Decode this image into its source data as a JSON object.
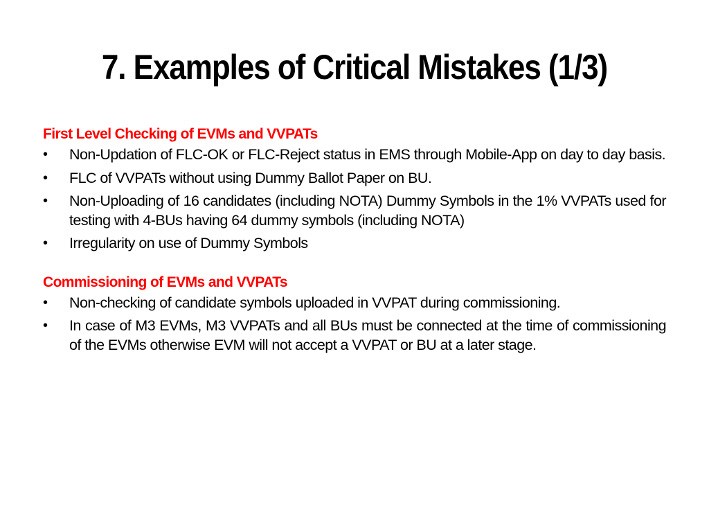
{
  "slide": {
    "title": "7. Examples of Critical Mistakes (1/3)",
    "accent_color": "#ff0000",
    "bullet_glyph": "•",
    "sections": [
      {
        "heading": "First Level Checking of EVMs and VVPATs",
        "items": [
          "Non-Updation of FLC-OK or FLC-Reject status in EMS through Mobile-App on day to day basis.",
          "FLC of VVPATs without using Dummy Ballot Paper on BU.",
          "Non-Uploading of 16 candidates (including NOTA) Dummy Symbols in the 1% VVPATs used for testing with 4-BUs having 64 dummy symbols (including NOTA)",
          "Irregularity on use of Dummy Symbols"
        ]
      },
      {
        "heading": "Commissioning of EVMs and VVPATs",
        "items": [
          "Non-checking of candidate symbols uploaded in VVPAT during commissioning.",
          "In case of M3 EVMs, M3 VVPATs and all BUs must be connected at the time of commissioning of the EVMs otherwise EVM will not accept a VVPAT or BU at a later stage."
        ]
      }
    ]
  }
}
